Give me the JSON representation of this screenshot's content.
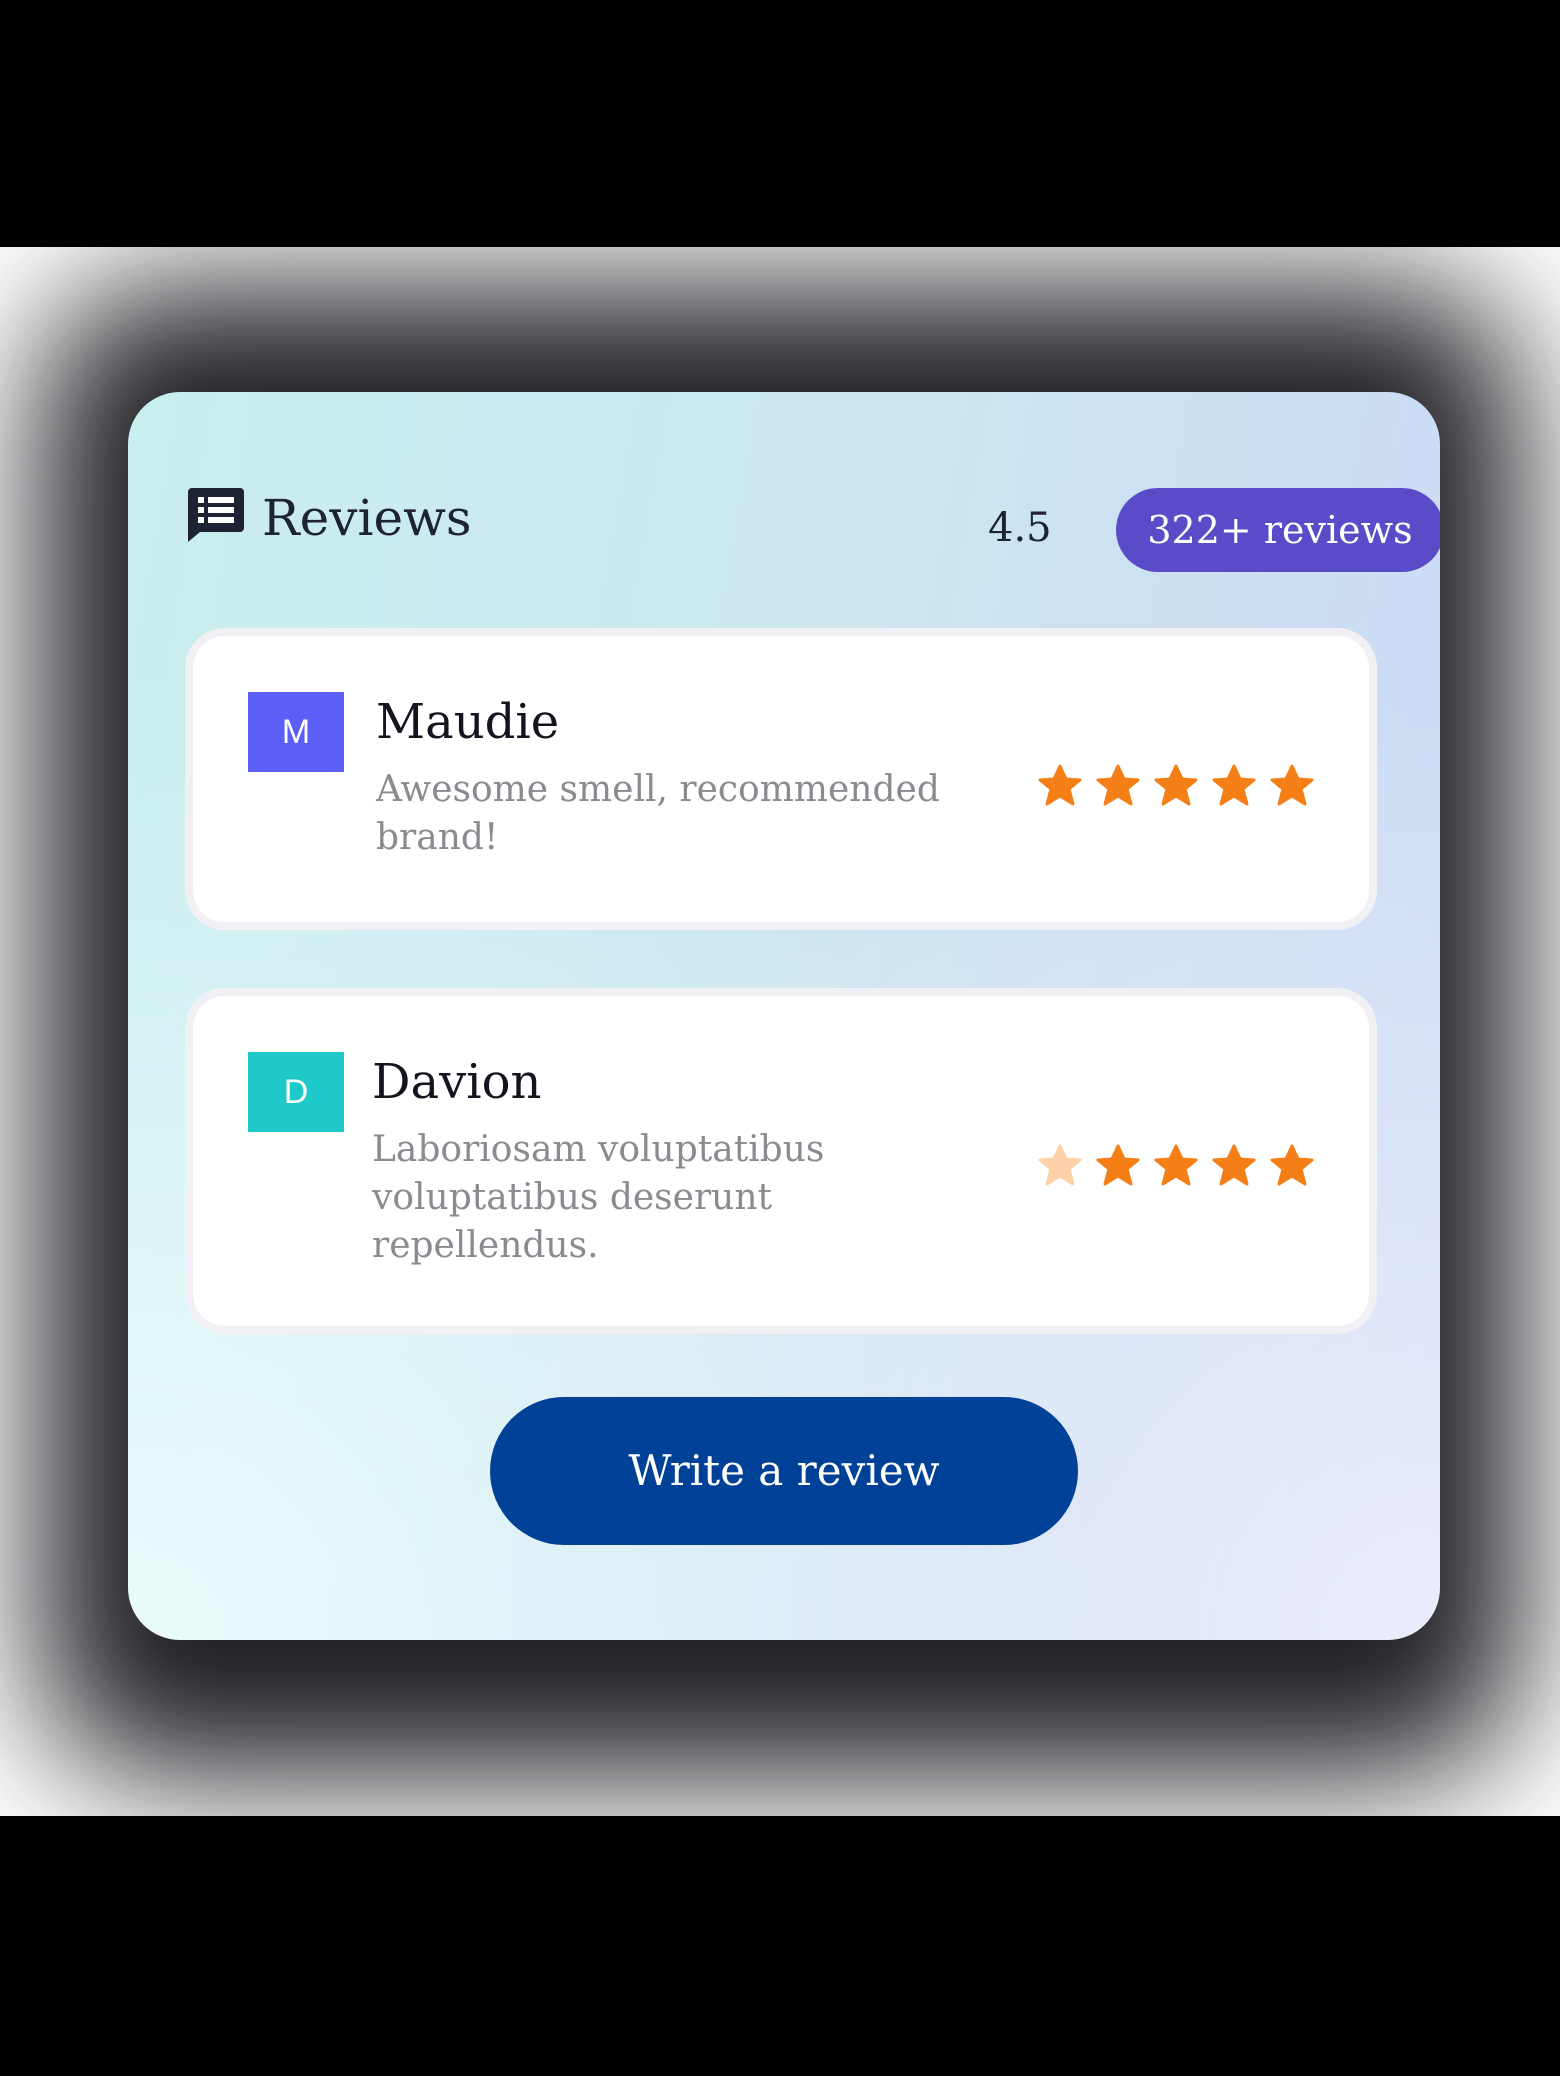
{
  "widget": {
    "title": "Reviews",
    "title_icon": "review-list-icon",
    "rating": "4.5",
    "review_count": "322+ reviews",
    "accent_color": "#5a4bc9"
  },
  "reviews": [
    {
      "initial": "M",
      "name": "Maudie",
      "text": "Awesome smell, recommended brand!",
      "avatar_color": "#5b5ef7",
      "stars_filled": 5,
      "stars_total": 5
    },
    {
      "initial": "D",
      "name": "Davion",
      "text": "Laboriosam voluptatibus voluptatibus deserunt repellendus.",
      "avatar_color": "#1ec9c9",
      "stars_filled": 4,
      "stars_total": 5
    }
  ],
  "star_colors": {
    "filled": "#f57f17",
    "empty": "#ffd1a8"
  },
  "actions": {
    "write_review_label": "Write a review",
    "button_color": "#004198"
  }
}
